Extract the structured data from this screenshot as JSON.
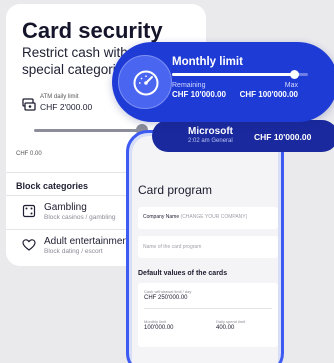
{
  "security": {
    "title": "Card security",
    "subtitle": "Restrict cash withdrawals for special categories",
    "atm": {
      "label": "ATM daily limit",
      "value": "CHF 2'000.00"
    },
    "slider_min": "CHF 0.00",
    "block_title": "Block categories",
    "blocks": [
      {
        "name": "Gambling",
        "desc": "Block casinos / gambling",
        "icon": "dice-icon"
      },
      {
        "name": "Adult entertainment",
        "desc": "Block dating / escort",
        "icon": "heart-icon"
      }
    ]
  },
  "monthly_limit": {
    "title": "Monthly limit",
    "remaining_label": "Remaining",
    "remaining_value": "CHF 10'000.00",
    "max_label": "Max",
    "max_value": "CHF 100'000.00",
    "progress": 0.9,
    "icon": "gauge-icon"
  },
  "transaction": {
    "merchant": "Microsoft",
    "time_category": "2:02 am  General",
    "amount": "CHF 10'000.00"
  },
  "card_program": {
    "title": "Card program",
    "company_label": "Company Name",
    "company_placeholder": "(CHANGE YOUR COMPANY)",
    "program_placeholder": "Name of the card program",
    "defaults_title": "Default values of the cards",
    "cash_label": "Cash withdrawal limit / day",
    "cash_value": "CHF 250'000.00",
    "monthly_label": "Monthly limit",
    "monthly_value": "100'000.00",
    "daily_label": "Daily spend limit",
    "daily_value": "400.00"
  },
  "colors": {
    "accent": "#1f3bd6",
    "accent_dark": "#1a2a9e",
    "phone_border": "#3d5bf2",
    "background": "#eaeaed"
  }
}
